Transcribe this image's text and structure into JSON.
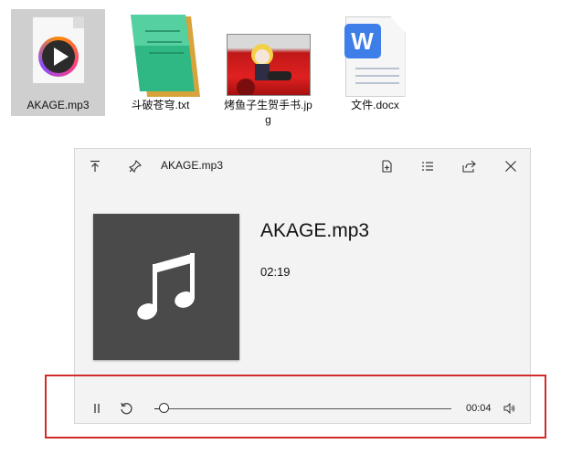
{
  "desktop": {
    "icons": [
      {
        "label": "AKAGE.mp3",
        "type": "audio-file-icon",
        "selected": true
      },
      {
        "label": "斗破苍穹.txt",
        "type": "notepad-file-icon",
        "selected": false
      },
      {
        "label": "烤鱼子生贺手书.jpg",
        "type": "image-file-icon",
        "selected": false
      },
      {
        "label": "文件.docx",
        "type": "wps-document-icon",
        "selected": false
      }
    ]
  },
  "player": {
    "window_title": "AKAGE.mp3",
    "track_title": "AKAGE.mp3",
    "duration": "02:19",
    "position": "00:04",
    "progress_fraction": 0.03,
    "artwork_icon": "music-note-icon",
    "titlebar_buttons": [
      "keep-on-top-icon",
      "pin-icon",
      "open-file-icon",
      "playlist-icon",
      "share-icon",
      "close-icon"
    ],
    "control_buttons": [
      "pause-icon",
      "replay-icon",
      "volume-icon"
    ]
  },
  "colors": {
    "player_bg": "#f3f3f3",
    "artwork_bg": "#4a4a4a",
    "highlight_border": "#d12c2c",
    "selected_icon_bg": "#cfcfcf"
  }
}
